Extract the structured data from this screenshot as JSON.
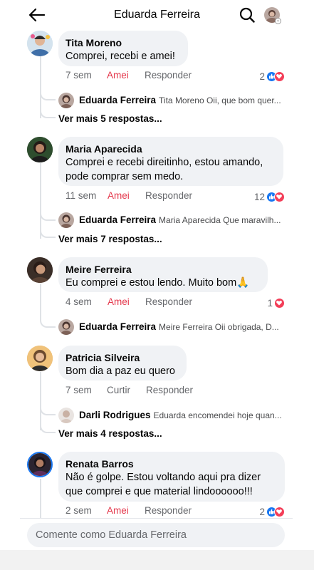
{
  "header": {
    "title": "Eduarda Ferreira",
    "back_icon": "arrow-left-icon",
    "search_icon": "search-icon",
    "caret": "⌄"
  },
  "colors": {
    "love": "#e4374b",
    "like": "#1877f2",
    "heart": "#f33e58",
    "bubble": "#f0f2f5"
  },
  "comments": [
    {
      "name": "Tita Moreno",
      "text": [
        "Comprei, recebi e amei!"
      ],
      "time": "7 sem",
      "reaction_label": "Amei",
      "reply_label": "Responder",
      "reaction_count": "2",
      "reply": {
        "name": "Eduarda Ferreira",
        "text": "Tita Moreno Oii, que bom quer..."
      },
      "more": "Ver mais 5 respostas..."
    },
    {
      "name": "Maria Aparecida",
      "text": [
        "Comprei e recebi direitinho, estou amando,",
        "pode comprar sem medo."
      ],
      "time": "11 sem",
      "reaction_label": "Amei",
      "reply_label": "Responder",
      "reaction_count": "12",
      "reply": {
        "name": "Eduarda Ferreira",
        "text": "Maria Aparecida Que maravilh..."
      },
      "more": "Ver mais 7 respostas..."
    },
    {
      "name": "Meire Ferreira",
      "text": [
        "Eu comprei e estou lendo. Muito bom🙏"
      ],
      "time": "4 sem",
      "reaction_label": "Amei",
      "reply_label": "Responder",
      "reaction_count": "1",
      "reply": {
        "name": "Eduarda Ferreira",
        "text": "Meire Ferreira  Oii obrigada, D..."
      }
    },
    {
      "name": "Patricia Silveira",
      "text": [
        "Bom dia a paz eu quero"
      ],
      "time": "7 sem",
      "reaction_label": "Curtir",
      "reply_label": "Responder",
      "reply": {
        "name": "Darli Rodrigues",
        "text": "Eduarda encomendei hoje quan..."
      },
      "more": "Ver mais 4 respostas..."
    },
    {
      "name": "Renata Barros",
      "text": [
        "Não é golpe. Estou voltando aqui pra dizer",
        "que comprei e que material lindoooooo!!!"
      ],
      "time": "2 sem",
      "reaction_label": "Amei",
      "reply_label": "Responder",
      "reaction_count": "2"
    }
  ],
  "composer": {
    "placeholder": "Comente como Eduarda Ferreira"
  }
}
